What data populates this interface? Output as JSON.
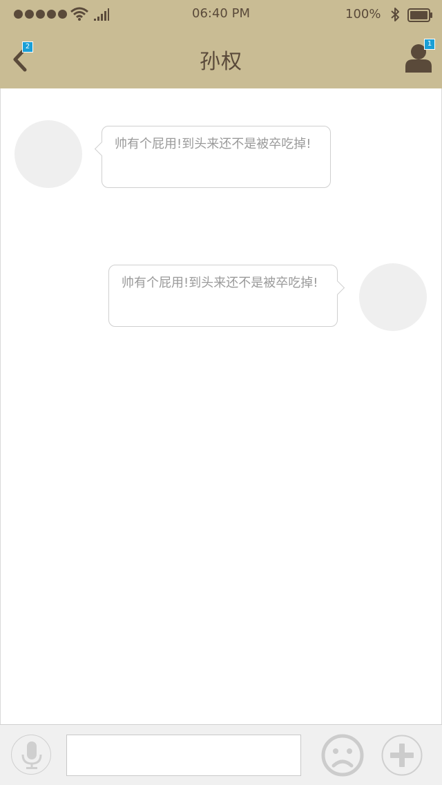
{
  "status_bar": {
    "time": "06:40 PM",
    "battery_percent": "100%",
    "signal_dots": 5,
    "icons": [
      "signal-dots-icon",
      "wifi-icon",
      "cellular-bars-icon",
      "bluetooth-icon",
      "battery-icon"
    ]
  },
  "nav": {
    "title": "孙权",
    "back_badge": "2",
    "profile_badge": "1",
    "icons": [
      "chevron-left-icon",
      "person-icon"
    ]
  },
  "messages": [
    {
      "side": "left",
      "text": "帅有个屁用!到头来还不是被卒吃掉!"
    },
    {
      "side": "right",
      "text": "帅有个屁用!到头来还不是被卒吃掉!"
    }
  ],
  "toolbar": {
    "input_value": "",
    "input_placeholder": "",
    "icons": [
      "microphone-icon",
      "sad-face-icon",
      "plus-icon"
    ]
  },
  "colors": {
    "header_bg": "#c9bc94",
    "header_text": "#5a4a3a",
    "badge": "#1a9fd6",
    "toolbar_bg": "#f0f0f0",
    "avatar_placeholder": "#efefef"
  }
}
